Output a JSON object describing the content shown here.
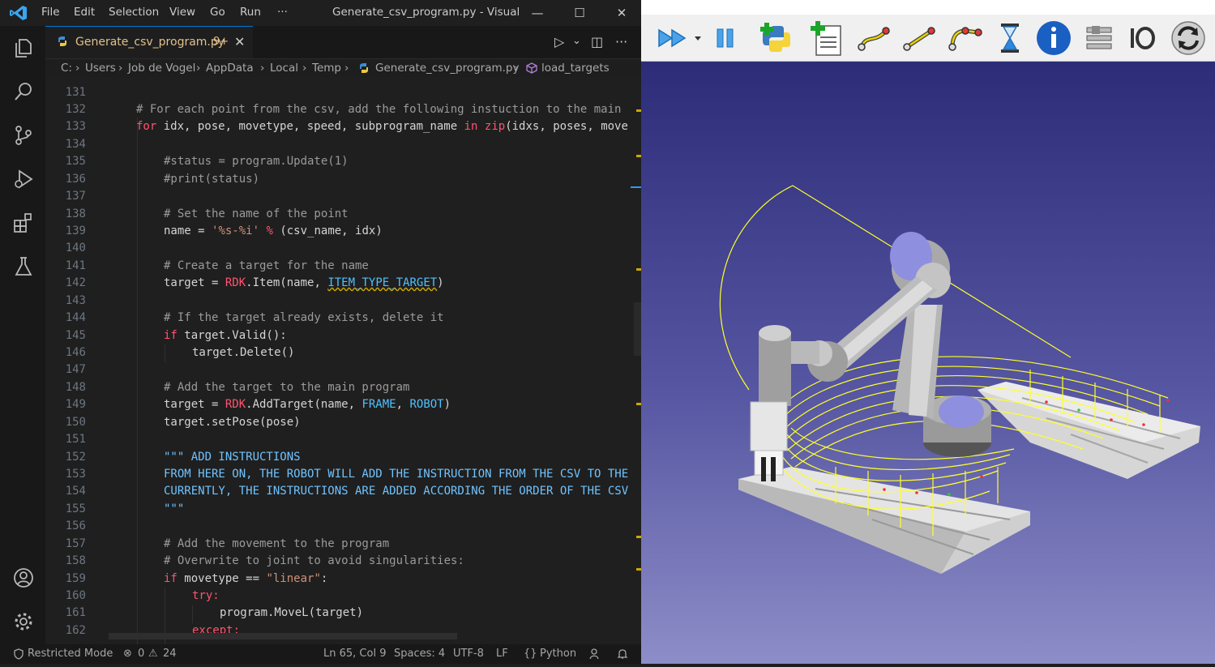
{
  "window": {
    "menu": [
      "File",
      "Edit",
      "Selection",
      "View",
      "Go",
      "Run",
      "···"
    ],
    "title": "Generate_csv_program.py - Visual St...",
    "controls": [
      "—",
      "☐",
      "✕"
    ]
  },
  "activity_icons": [
    "explorer-icon",
    "search-icon",
    "source-control-icon",
    "run-debug-icon",
    "extensions-icon",
    "testing-icon",
    "account-icon",
    "settings-gear-icon"
  ],
  "tab": {
    "label": "Generate_csv_program.py",
    "badge": "9+",
    "close": "✕"
  },
  "tab_actions": [
    "▷",
    "⌄",
    "◫",
    "···"
  ],
  "breadcrumb": [
    "C:",
    "Users",
    "Job de Vogel",
    "AppData",
    "Local",
    "Temp",
    "Generate_csv_program.py",
    "load_targets"
  ],
  "code": {
    "line_numbers": [
      "131",
      "132",
      "133",
      "134",
      "135",
      "136",
      "137",
      "138",
      "139",
      "140",
      "141",
      "142",
      "143",
      "144",
      "145",
      "146",
      "147",
      "148",
      "149",
      "150",
      "151",
      "152",
      "153",
      "154",
      "155",
      "156",
      "157",
      "158",
      "159",
      "160",
      "161",
      "162"
    ],
    "l132": "# For each point from the csv, add the following instuction to the main",
    "l133_for": "for",
    "l133_vars": " idx, pose, movetype, speed, subprogram_name ",
    "l133_in": "in",
    "l133_zip": "zip",
    "l133_rest": "(idxs, poses, move",
    "l135": "#status = program.Update(1)",
    "l136": "#print(status)",
    "l138": "# Set the name of the point",
    "l139_a": "name = ",
    "l139_str": "'%s-%i'",
    "l139_op": " % ",
    "l139_b": "(csv_name, idx)",
    "l141": "# Create a target for the name",
    "l142_a": "target = ",
    "l142_rdk": "RDK",
    "l142_b": ".Item(name, ",
    "l142_const": "ITEM_TYPE_TARGET",
    "l142_c": ")",
    "l144": "# If the target already exists, delete it",
    "l145_if": "if",
    "l145_rest": " target.Valid():",
    "l146": "target.Delete()",
    "l148": "# Add the target to the main program",
    "l149_a": "target = ",
    "l149_rdk": "RDK",
    "l149_b": ".AddTarget(name, ",
    "l149_frame": "FRAME",
    "l149_c": ", ",
    "l149_robot": "ROBOT",
    "l149_d": ")",
    "l150": "target.setPose(pose)",
    "l152": "\"\"\" ADD INSTRUCTIONS",
    "l153": "FROM HERE ON, THE ROBOT WILL ADD THE INSTRUCTION FROM THE CSV TO THE",
    "l154": "CURRENTLY, THE INSTRUCTIONS ARE ADDED ACCORDING THE ORDER OF THE CSV",
    "l155": "\"\"\"",
    "l157": "# Add the movement to the program",
    "l158": "# Overwrite to joint to avoid singularities:",
    "l159_if": "if",
    "l159_a": " movetype == ",
    "l159_str": "\"linear\"",
    "l159_b": ":",
    "l160": "try:",
    "l161": "program.MoveL(target)",
    "l162": "except:"
  },
  "status": {
    "restricted": "Restricted Mode",
    "errors": "0",
    "warnings": "24",
    "position": "Ln 65, Col 9",
    "spaces": "Spaces: 4",
    "encoding": "UTF-8",
    "eol": "LF",
    "language": "Python"
  },
  "robodk_toolbar": [
    "run-program-icon",
    "dropdown-arrow-icon",
    "pause-icon",
    "python-program-icon",
    "add-program-icon",
    "move-joint-icon",
    "move-linear-icon",
    "move-circular-icon",
    "pause-instruction-icon",
    "show-message-icon",
    "program-call-icon",
    "set-digital-output-icon",
    "refresh-icon"
  ],
  "colors": {
    "accent": "#0078d4",
    "scene_top": "#2c2c78",
    "scene_bottom": "#8d8dc8",
    "path": "#ffff2a"
  }
}
